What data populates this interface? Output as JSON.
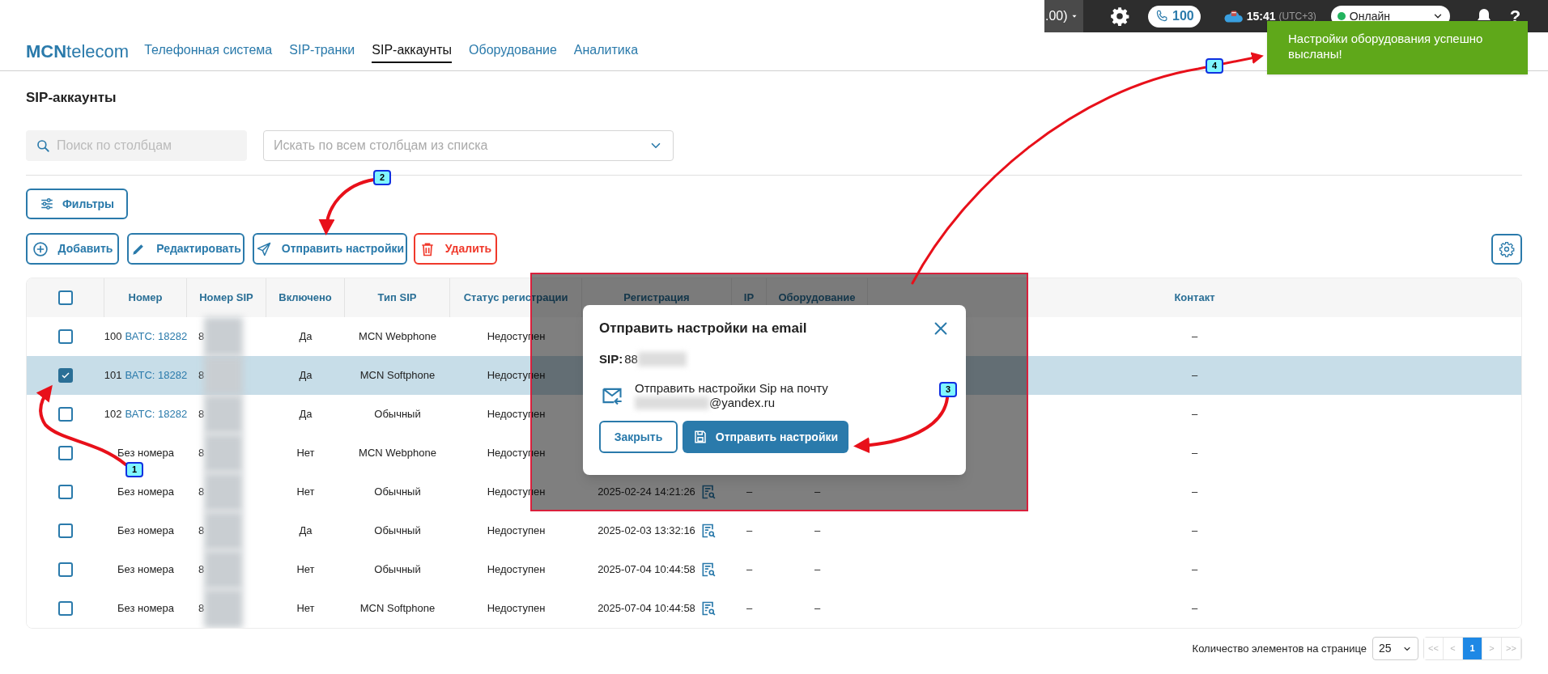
{
  "top_bar": {
    "balance": ".00)",
    "calls": "100",
    "time": "15:41",
    "timezone": "(UTC+3)",
    "status": {
      "label": "Онлайн",
      "color": "#22b35e"
    },
    "help": "?"
  },
  "toast": {
    "message": "Настройки оборудования успешно высланы!"
  },
  "logo": "**MCN**telecom",
  "nav": [
    {
      "label": "Телефонная система",
      "selected": false
    },
    {
      "label": "SIP-транки",
      "selected": false
    },
    {
      "label": "SIP-аккаунты",
      "selected": true
    },
    {
      "label": "Оборудование",
      "selected": false
    },
    {
      "label": "Аналитика",
      "selected": false
    }
  ],
  "page_title": "SIP-аккаунты",
  "search": {
    "placeholder": "Поиск по столбцам"
  },
  "column_select": {
    "placeholder": "Искать по всем столбцам из списка"
  },
  "filters_button": "Фильтры",
  "actions": [
    {
      "kind": "add",
      "label": "Добавить"
    },
    {
      "kind": "edit",
      "label": "Редактировать"
    },
    {
      "kind": "send",
      "label": "Отправить настройки"
    },
    {
      "kind": "delete",
      "label": "Удалить"
    }
  ],
  "table": {
    "columns": [
      "Номер",
      "Номер SIP",
      "Включено",
      "Тип SIP",
      "Статус регистрации",
      "Регистрация",
      "IP",
      "Оборудование",
      "Контакт"
    ],
    "all_selected": false,
    "rows": [
      {
        "number": "100",
        "link": "ВАТС: 18282",
        "sip": "8",
        "enabled": "Да",
        "sip_type": "MCN Webphone",
        "status": "Недоступен",
        "contact": "–",
        "selected": false
      },
      {
        "number": "101",
        "link": "ВАТС: 18282",
        "sip": "8",
        "enabled": "Да",
        "sip_type": "MCN Softphone",
        "status": "Недоступен",
        "contact": "–",
        "selected": true
      },
      {
        "number": "102",
        "link": "ВАТС: 18282",
        "sip": "8",
        "enabled": "Да",
        "sip_type": "Обычный",
        "status": "Недоступен",
        "contact": "–",
        "selected": false
      },
      {
        "number": "Без номера",
        "sip": "8",
        "enabled": "Нет",
        "sip_type": "MCN Webphone",
        "status": "Недоступен",
        "contact": "–",
        "selected": false
      },
      {
        "number": "Без номера",
        "sip": "8",
        "enabled": "Нет",
        "sip_type": "Обычный",
        "status": "Недоступен",
        "registration": "2025-02-24 14:21:26",
        "ip": "–",
        "equipment": "–",
        "contact": "–",
        "selected": false
      },
      {
        "number": "Без номера",
        "sip": "8",
        "enabled": "Да",
        "sip_type": "Обычный",
        "status": "Недоступен",
        "registration": "2025-02-03 13:32:16",
        "ip": "–",
        "equipment": "–",
        "contact": "–",
        "selected": false
      },
      {
        "number": "Без номера",
        "sip": "8",
        "enabled": "Нет",
        "sip_type": "Обычный",
        "status": "Недоступен",
        "registration": "2025-07-04 10:44:58",
        "ip": "–",
        "equipment": "–",
        "contact": "–",
        "selected": false
      },
      {
        "number": "Без номера",
        "sip": "8",
        "enabled": "Нет",
        "sip_type": "MCN Softphone",
        "status": "Недоступен",
        "registration": "2025-07-04 10:44:58",
        "ip": "–",
        "equipment": "–",
        "contact": "–",
        "selected": false
      }
    ]
  },
  "modal": {
    "title": "Отправить настройки на email",
    "sip_label": "SIP:",
    "sip_value": "88",
    "message": "Отправить настройки Sip на почту",
    "email": "@yandex.ru",
    "buttons": [
      {
        "kind": "secondary",
        "label": "Закрыть"
      },
      {
        "kind": "primary",
        "label": "Отправить настройки"
      }
    ]
  },
  "pagination": {
    "label": "Количество элементов на странице",
    "page_size": "25",
    "pages": [
      {
        "label": "<<",
        "selected": false
      },
      {
        "label": "<",
        "selected": false
      },
      {
        "label": "1",
        "selected": true
      },
      {
        "label": ">",
        "selected": false
      },
      {
        "label": ">>",
        "selected": false
      }
    ]
  },
  "annotations": [
    {
      "label": "1"
    },
    {
      "label": "2"
    },
    {
      "label": "3"
    },
    {
      "label": "4"
    }
  ]
}
